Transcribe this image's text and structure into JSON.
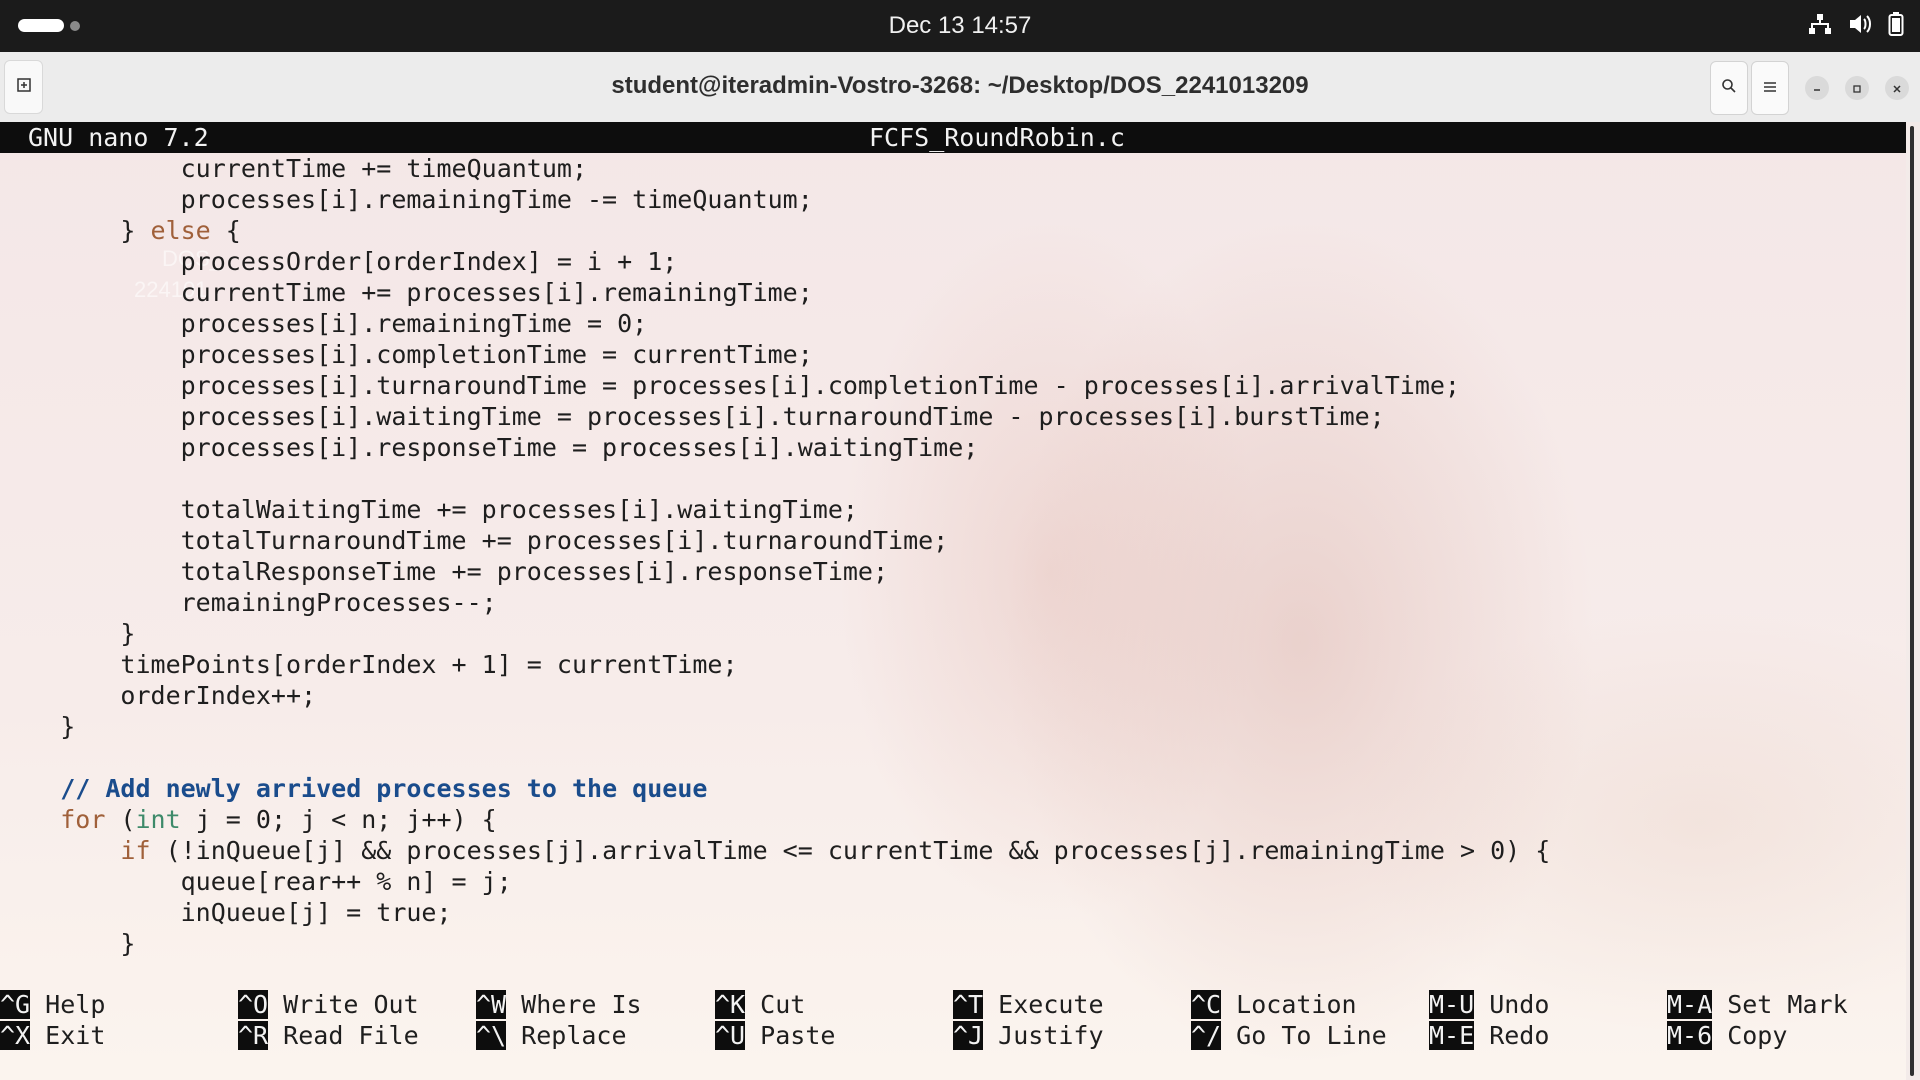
{
  "system_bar": {
    "clock": "Dec 13  14:57",
    "icons": [
      "network-icon",
      "volume-icon",
      "battery-icon"
    ]
  },
  "window": {
    "title": "student@iteradmin-Vostro-3268: ~/Desktop/DOS_2241013209",
    "buttons": [
      "new-tab-icon",
      "search-icon",
      "menu-icon",
      "minimize-icon",
      "maximize-icon",
      "close-icon"
    ]
  },
  "nano": {
    "version": "GNU nano 7.2",
    "filename": "FCFS_RoundRobin.c"
  },
  "desktop_ghost": {
    "line1": "DOS_",
    "line2": "224101"
  },
  "code_lines": [
    {
      "text": "            currentTime += timeQuantum;"
    },
    {
      "text": "            processes[i].remainingTime -= timeQuantum;"
    },
    {
      "text": "        } ",
      "kw": "else",
      "rest": " {"
    },
    {
      "text": "            processOrder[orderIndex] = i + 1;"
    },
    {
      "text": "            currentTime += processes[i].remainingTime;"
    },
    {
      "text": "            processes[i].remainingTime = 0;"
    },
    {
      "text": "            processes[i].completionTime = currentTime;"
    },
    {
      "text": "            processes[i].turnaroundTime = processes[i].completionTime - processes[i].arrivalTime;"
    },
    {
      "text": "            processes[i].waitingTime = processes[i].turnaroundTime - processes[i].burstTime;"
    },
    {
      "text": "            processes[i].responseTime = processes[i].waitingTime;"
    },
    {
      "text": ""
    },
    {
      "text": "            totalWaitingTime += processes[i].waitingTime;"
    },
    {
      "text": "            totalTurnaroundTime += processes[i].turnaroundTime;"
    },
    {
      "text": "            totalResponseTime += processes[i].responseTime;"
    },
    {
      "text": "            remainingProcesses--;"
    },
    {
      "text": "        }"
    },
    {
      "text": "        timePoints[orderIndex + 1] = currentTime;"
    },
    {
      "text": "        orderIndex++;"
    },
    {
      "text": "    }"
    },
    {
      "text": ""
    },
    {
      "text": "    ",
      "comment": "// Add newly arrived processes to the queue"
    },
    {
      "text": "    ",
      "kw": "for",
      "rest": " (",
      "typ": "int",
      "rest2": " j = 0; j < n; j++) {"
    },
    {
      "text": "        ",
      "kw": "if",
      "rest": " (!inQueue[j] && processes[j].arrivalTime <= currentTime && processes[j].remainingTime > 0) {"
    },
    {
      "text": "            queue[rear++ % n] = j;"
    },
    {
      "text": "            inQueue[j] = true;"
    },
    {
      "text": "        }"
    }
  ],
  "shortcuts": [
    {
      "key": "^G",
      "label": "Help"
    },
    {
      "key": "^X",
      "label": "Exit"
    },
    {
      "key": "^O",
      "label": "Write Out"
    },
    {
      "key": "^R",
      "label": "Read File"
    },
    {
      "key": "^W",
      "label": "Where Is"
    },
    {
      "key": "^\\",
      "label": "Replace"
    },
    {
      "key": "^K",
      "label": "Cut"
    },
    {
      "key": "^U",
      "label": "Paste"
    },
    {
      "key": "^T",
      "label": "Execute"
    },
    {
      "key": "^J",
      "label": "Justify"
    },
    {
      "key": "^C",
      "label": "Location"
    },
    {
      "key": "^/",
      "label": "Go To Line"
    },
    {
      "key": "M-U",
      "label": "Undo"
    },
    {
      "key": "M-E",
      "label": "Redo"
    },
    {
      "key": "M-A",
      "label": "Set Mark"
    },
    {
      "key": "M-6",
      "label": "Copy"
    }
  ]
}
